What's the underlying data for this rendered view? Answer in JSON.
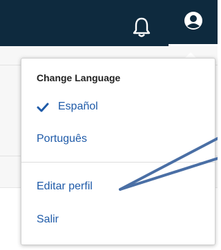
{
  "header": {
    "notifications_icon": "bell-icon",
    "profile_icon": "user-circle-icon"
  },
  "user_menu": {
    "heading": "Change Language",
    "languages": [
      {
        "label": "Español",
        "selected": true
      },
      {
        "label": "Português",
        "selected": false
      }
    ],
    "edit_profile_label": "Editar perfil",
    "logout_label": "Salir"
  },
  "colors": {
    "topbar": "#0e2a3e",
    "link": "#1e5aa8",
    "annotation_arrow": "#4a6fa5"
  }
}
